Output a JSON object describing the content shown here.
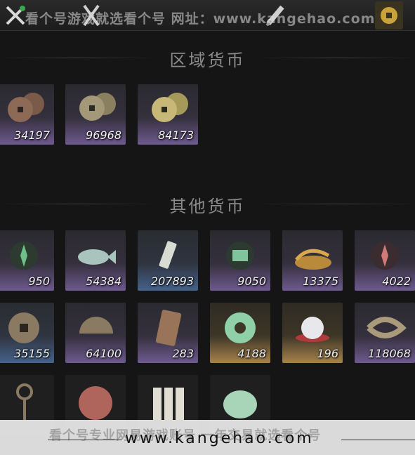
{
  "topbar": {
    "watermark": "看个号游戏就选看个号  网址：www.kangehao.com",
    "icons": [
      "crossed-swords-icon",
      "crossed-blades-icon",
      "scroll-icon",
      "coin-icon"
    ]
  },
  "sections": {
    "regional": {
      "title": "区域货币"
    },
    "other": {
      "title": "其他货币"
    }
  },
  "regional_items": [
    {
      "count": "34197",
      "icon": "copper-coins-icon",
      "rarity": "purple"
    },
    {
      "count": "96968",
      "icon": "silver-coins-icon",
      "rarity": "purple"
    },
    {
      "count": "84173",
      "icon": "gold-coins-icon",
      "rarity": "purple"
    }
  ],
  "other_items_row1": [
    {
      "count": "950",
      "icon": "jade-token-icon",
      "rarity": "purple"
    },
    {
      "count": "54384",
      "icon": "jade-fish-icon",
      "rarity": "purple"
    },
    {
      "count": "207893",
      "icon": "tablet-icon",
      "rarity": "blue"
    },
    {
      "count": "9050",
      "icon": "map-icon",
      "rarity": "purple"
    },
    {
      "count": "13375",
      "icon": "grain-pile-icon",
      "rarity": "purple"
    },
    {
      "count": "4022",
      "icon": "red-token-icon",
      "rarity": "purple"
    }
  ],
  "other_items_row2": [
    {
      "count": "35155",
      "icon": "ancient-coin-icon",
      "rarity": "blue"
    },
    {
      "count": "64100",
      "icon": "half-coin-icon",
      "rarity": "purple"
    },
    {
      "count": "283",
      "icon": "bronze-plaque-icon",
      "rarity": "purple"
    },
    {
      "count": "4188",
      "icon": "jade-disc-icon",
      "rarity": "gold"
    },
    {
      "count": "196",
      "icon": "pearl-icon",
      "rarity": "gold"
    },
    {
      "count": "118068",
      "icon": "coin-string-icon",
      "rarity": "purple"
    }
  ],
  "other_items_row3": [
    {
      "icon": "key-coin-icon"
    },
    {
      "icon": "red-seal-icon"
    },
    {
      "icon": "paper-notes-icon"
    },
    {
      "icon": "jade-stone-icon"
    }
  ],
  "footer": {
    "watermark": "看个号专业网易游戏账号 一年交易就选看个号",
    "url": "www.kangehao.com"
  },
  "colors": {
    "background": "#151515",
    "purple_rarity": "#6e5a8f",
    "blue_rarity": "#46628a",
    "gold_rarity": "#a7834b"
  }
}
